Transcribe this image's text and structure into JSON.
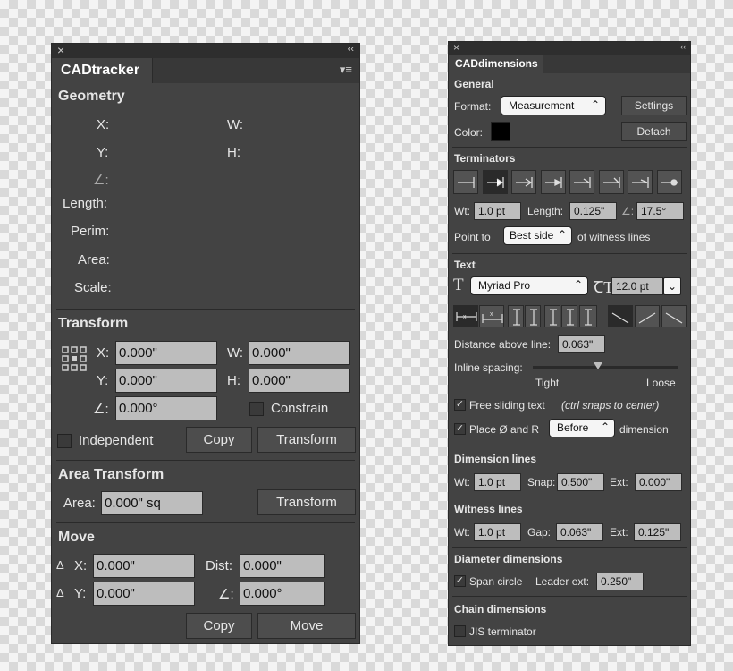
{
  "tracker": {
    "close": "×",
    "collapse": "‹‹",
    "tab": "CADtracker",
    "menu": "▾≡",
    "geometry": {
      "title": "Geometry",
      "x": "X:",
      "w": "W:",
      "y": "Y:",
      "h": "H:",
      "angle": "∠:",
      "length": "Length:",
      "perim": "Perim:",
      "area": "Area:",
      "scale": "Scale:"
    },
    "transform": {
      "title": "Transform",
      "x_label": "X:",
      "x_value": "0.000\"",
      "w_label": "W:",
      "w_value": "0.000\"",
      "y_label": "Y:",
      "y_value": "0.000\"",
      "h_label": "H:",
      "h_value": "0.000\"",
      "angle_label": "∠:",
      "angle_value": "0.000°",
      "constrain": "Constrain",
      "independent": "Independent",
      "copy": "Copy",
      "transform": "Transform"
    },
    "area_transform": {
      "title": "Area Transform",
      "area_label": "Area:",
      "area_value": "0.000\" sq",
      "transform": "Transform"
    },
    "move": {
      "title": "Move",
      "delta": "Δ",
      "x_label": "X:",
      "x_value": "0.000\"",
      "dist_label": "Dist:",
      "dist_value": "0.000\"",
      "y_label": "Y:",
      "y_value": "0.000\"",
      "angle_label": "∠:",
      "angle_value": "0.000°",
      "copy": "Copy",
      "move": "Move"
    }
  },
  "dims": {
    "close": "×",
    "collapse": "‹‹",
    "tab": "CADdimensions",
    "general": {
      "title": "General",
      "format_label": "Format:",
      "format_value": "Measurement",
      "settings": "Settings",
      "color_label": "Color:",
      "color_value": "#000000",
      "detach": "Detach"
    },
    "terminators": {
      "title": "Terminators",
      "selected_index": 1,
      "wt_label": "Wt:",
      "wt_value": "1.0 pt",
      "length_label": "Length:",
      "length_value": "0.125\"",
      "angle_label": "∠:",
      "angle_value": "17.5°",
      "point_to": "Point to",
      "point_value": "Best side",
      "point_suffix": "of witness lines"
    },
    "text": {
      "title": "Text",
      "font": "Myriad Pro",
      "size": "12.0 pt",
      "distance_label": "Distance above line:",
      "distance_value": "0.063\"",
      "inline_label": "Inline spacing:",
      "tight": "Tight",
      "loose": "Loose",
      "inline_spacing_fraction": 0.45,
      "free_sliding": "Free sliding text",
      "free_sliding_note": "(ctrl snaps to center)",
      "place_label": "Place Ø and R",
      "place_value": "Before",
      "place_suffix": "dimension"
    },
    "dimension_lines": {
      "title": "Dimension lines",
      "wt_label": "Wt:",
      "wt_value": "1.0 pt",
      "snap_label": "Snap:",
      "snap_value": "0.500\"",
      "ext_label": "Ext:",
      "ext_value": "0.000\""
    },
    "witness_lines": {
      "title": "Witness lines",
      "wt_label": "Wt:",
      "wt_value": "1.0 pt",
      "gap_label": "Gap:",
      "gap_value": "0.063\"",
      "ext_label": "Ext:",
      "ext_value": "0.125\""
    },
    "diameter": {
      "title": "Diameter dimensions",
      "span_circle": "Span circle",
      "leader_label": "Leader ext:",
      "leader_value": "0.250\""
    },
    "chain": {
      "title": "Chain dimensions",
      "jis": "JIS terminator"
    }
  }
}
